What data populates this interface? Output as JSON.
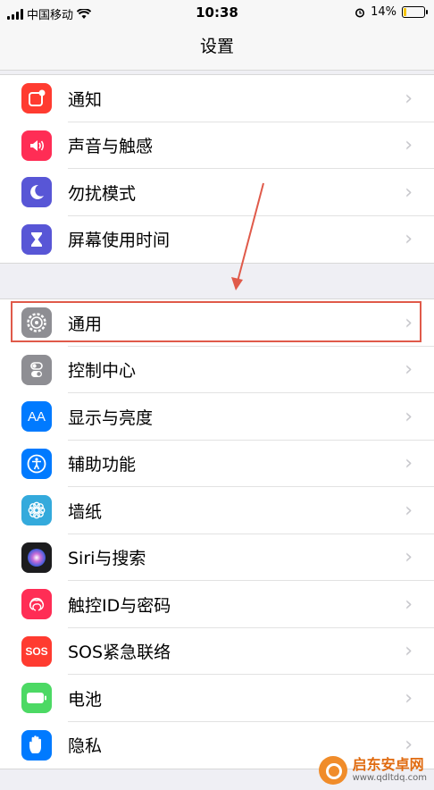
{
  "status_bar": {
    "carrier": "中国移动",
    "time": "10:38",
    "battery": "14%",
    "battery_level": 0.14,
    "icons": [
      "signal-icon",
      "wifi-icon",
      "alarm-icon",
      "battery-icon"
    ]
  },
  "nav": {
    "title": "设置"
  },
  "group1": [
    {
      "label": "通知",
      "icon": "notifications-icon",
      "color": "#ff3b30"
    },
    {
      "label": "声音与触感",
      "icon": "sound-icon",
      "color": "#ff2d55"
    },
    {
      "label": "勿扰模式",
      "icon": "moon-icon",
      "color": "#5856d6"
    },
    {
      "label": "屏幕使用时间",
      "icon": "hourglass-icon",
      "color": "#5856d6"
    }
  ],
  "group2": [
    {
      "label": "通用",
      "icon": "gear-icon",
      "color": "#8e8e93"
    },
    {
      "label": "控制中心",
      "icon": "toggles-icon",
      "color": "#8e8e93"
    },
    {
      "label": "显示与亮度",
      "icon": "AA",
      "color": "#007aff"
    },
    {
      "label": "辅助功能",
      "icon": "accessibility-icon",
      "color": "#007aff"
    },
    {
      "label": "墙纸",
      "icon": "flower-icon",
      "color": "#34aadc"
    },
    {
      "label": "Siri与搜索",
      "icon": "siri-icon",
      "color": "#1c1c1e"
    },
    {
      "label": "触控ID与密码",
      "icon": "fingerprint-icon",
      "color": "#ff2d55"
    },
    {
      "label": "SOS紧急联络",
      "icon": "SOS",
      "color": "#ff3b30"
    },
    {
      "label": "电池",
      "icon": "battery-icon",
      "color": "#4cd964"
    },
    {
      "label": "隐私",
      "icon": "hand-icon",
      "color": "#007aff"
    }
  ],
  "watermark": {
    "name": "启东安卓网",
    "url": "www.qdltdq.com"
  },
  "annotation": {
    "color": "#e05a4a"
  }
}
